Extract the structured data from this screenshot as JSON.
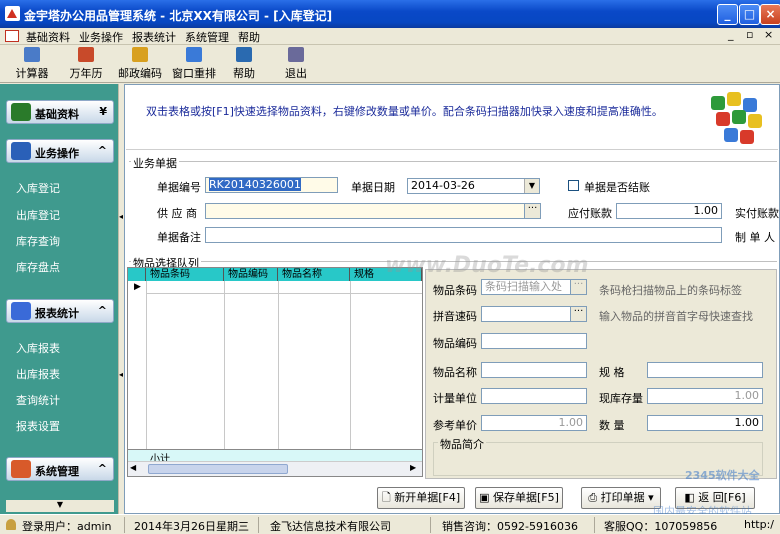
{
  "window": {
    "title": "金宇塔办公用品管理系统 - 北京XX有限公司 - [入库登记]"
  },
  "menu": [
    "基础资料",
    "业务操作",
    "报表统计",
    "系统管理",
    "帮助"
  ],
  "mdi_controls": [
    "_",
    "▫",
    "×"
  ],
  "toolbar": [
    {
      "label": "计算器",
      "icon": "calculator-icon",
      "color": "#4a7bc8"
    },
    {
      "label": "万年历",
      "icon": "calendar-icon",
      "color": "#c84a2a"
    },
    {
      "label": "邮政编码",
      "icon": "envelope-icon",
      "color": "#d8a020"
    },
    {
      "label": "窗口重排",
      "icon": "windows-icon",
      "color": "#3a7ad8"
    },
    {
      "label": "帮助",
      "icon": "help-book-icon",
      "color": "#2a6ab0"
    },
    {
      "label": "退出",
      "icon": "exit-door-icon",
      "color": "#6a6a9a"
    }
  ],
  "sidebar": {
    "groups": [
      {
        "label": "基础资料",
        "icon": "puzzle-icon",
        "items": []
      },
      {
        "label": "业务操作",
        "icon": "business-icon",
        "items": [
          "入库登记",
          "出库登记",
          "库存查询",
          "库存盘点"
        ]
      },
      {
        "label": "报表统计",
        "icon": "report-icon",
        "items": [
          "入库报表",
          "出库报表",
          "查询统计",
          "报表设置"
        ]
      },
      {
        "label": "系统管理",
        "icon": "people-icon",
        "items": []
      }
    ]
  },
  "hint": "双击表格或按[F1]快速选择物品资料，右键修改数量或单价。配合条码扫描器加快录入速度和提高准确性。",
  "voucher": {
    "section": "业务单据",
    "no_label": "单据编号",
    "no_value": "RK20140326001",
    "date_label": "单据日期",
    "date_value": "2014-03-26",
    "settled_label": "单据是否结账",
    "supplier_label": "供 应 商",
    "supplier_value": "",
    "payable_label": "应付账款",
    "payable_value": "1.00",
    "paid_label": "实付账款",
    "remark_label": "单据备注",
    "remark_value": "",
    "maker_label": "制 单 人"
  },
  "items": {
    "section": "物品选择队列",
    "columns": [
      "物品条码",
      "物品编码",
      "物品名称",
      "规格"
    ],
    "subtotal_label": "小计"
  },
  "detail": {
    "barcode_label": "物品条码",
    "barcode_placeholder": "条码扫描输入处",
    "barcode_tip": "条码枪扫描物品上的条码标签",
    "pinyin_label": "拼音速码",
    "pinyin_tip": "输入物品的拼音首字母快速查找",
    "code_label": "物品编码",
    "name_label": "物品名称",
    "spec_label": "规    格",
    "unit_label": "计量单位",
    "stock_label": "现库存量",
    "stock_value": "1.00",
    "price_label": "参考单价",
    "price_value": "1.00",
    "qty_label": "数    量",
    "qty_value": "1.00",
    "intro_label": "物品简介"
  },
  "buttons": {
    "new": "新开单据[F4]",
    "save": "保存单据[F5]",
    "print": "打印单据",
    "back": "返    回[F6]"
  },
  "status": {
    "user": "登录用户：admin",
    "date": "2014年3月26日星期三",
    "company": "金飞达信息技术有限公司",
    "sales": "销售咨询：0592-5916036",
    "qq": "客服QQ：107059856",
    "url": "http:/"
  },
  "watermarks": [
    "www.DuoTe.com",
    "2345软件大全",
    "国内最安全的软件站"
  ]
}
